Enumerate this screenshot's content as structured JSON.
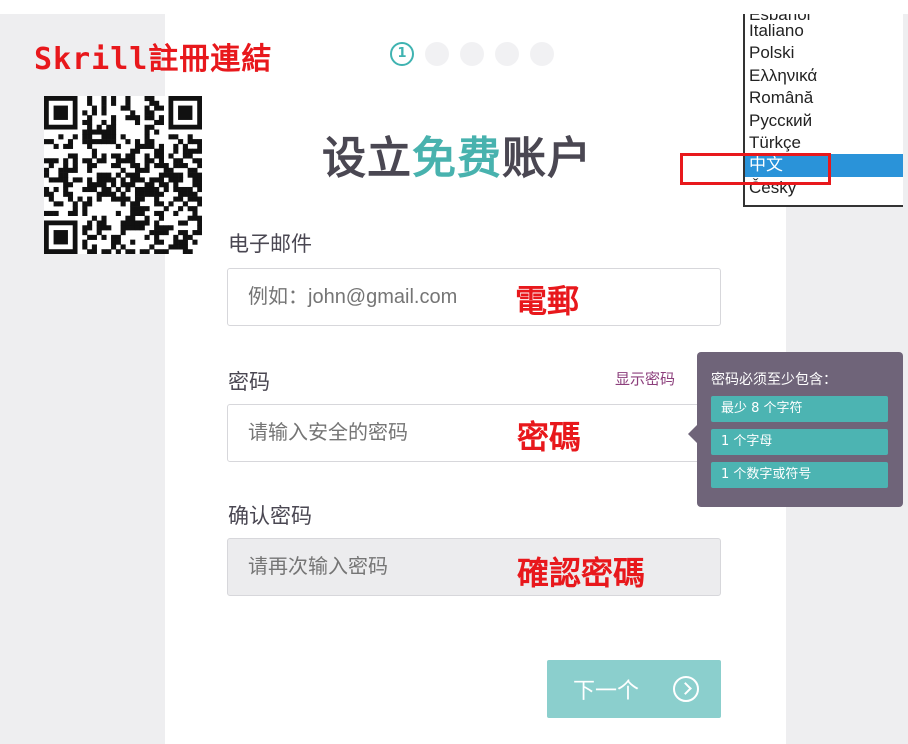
{
  "promo": {
    "text": "Skrill註冊連結"
  },
  "steps": {
    "current_label": "1",
    "count": 5
  },
  "title": {
    "before": "设立",
    "accent": "免费",
    "after": "账户"
  },
  "form": {
    "email_label": "电子邮件",
    "email_placeholder": "例如：john@gmail.com",
    "email_annotation": "電郵",
    "password_label": "密码",
    "show_password": "显示密码",
    "password_placeholder": "请输入安全的密码",
    "password_annotation": "密碼",
    "confirm_label": "确认密码",
    "confirm_placeholder": "请再次输入密码",
    "confirm_annotation": "確認密碼",
    "next_button": "下一个"
  },
  "tooltip": {
    "title": "密码必须至少包含：",
    "rules": [
      "最少 8 个字符",
      "1 个字母",
      "1 个数字或符号"
    ]
  },
  "languages": {
    "items": [
      "Español",
      "Italiano",
      "Polski",
      "Ελληνικά",
      "Română",
      "Русский",
      "Türkçe",
      "中文",
      "Česky"
    ],
    "selected": "中文"
  },
  "colors": {
    "accent": "#48b2ae",
    "annotation_red": "#e8181c",
    "selected_blue": "#2a93d9",
    "tooltip_bg": "#6f6479"
  }
}
